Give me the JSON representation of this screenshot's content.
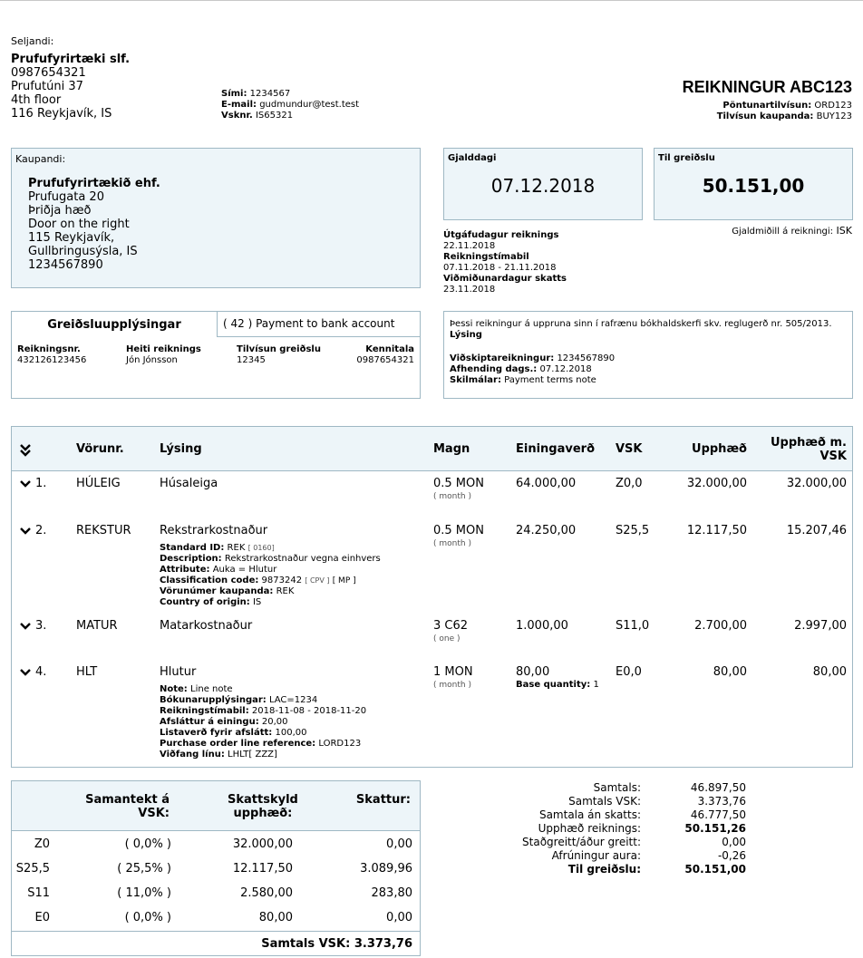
{
  "seller": {
    "label": "Seljandi:",
    "name": "Prufufyrirtæki slf.",
    "lines": [
      "0987654321",
      "Prufutúni 37",
      "4th floor",
      "116  Reykjavík, IS"
    ],
    "phone_label": "Sími:",
    "phone": "1234567",
    "email_label": "E-mail:",
    "email": "gudmundur@test.test",
    "vsk_label": "Vsknr.",
    "vsk": "IS65321"
  },
  "invoice": {
    "title": "REIKNINGUR  ABC123",
    "order_ref_label": "Pöntunartilvísun:",
    "order_ref": "ORD123",
    "buyer_ref_label": "Tilvísun kaupanda:",
    "buyer_ref": "BUY123"
  },
  "buyer": {
    "label": "Kaupandi:",
    "name": "Prufufyrirtækið ehf.",
    "lines": [
      "Prufugata 20",
      "Þriðja hæð",
      "Door on the right",
      "115  Reykjavík,",
      "Gullbringusýsla, IS",
      "1234567890"
    ]
  },
  "due": {
    "label": "Gjalddagi",
    "value": "07.12.2018"
  },
  "pay": {
    "label": "Til greiðslu",
    "value": "50.151,00"
  },
  "currency": {
    "label": "Gjaldmiðill á reikningi:",
    "value": "ISK"
  },
  "dates": {
    "issue_label": "Útgáfudagur reiknings",
    "issue": "22.11.2018",
    "period_label": "Reikningstímabil",
    "period": "07.11.2018 - 21.11.2018",
    "tax_label": "Viðmiðunardagur skatts",
    "tax": "23.11.2018"
  },
  "payment": {
    "title": "Greiðsluupplýsingar",
    "method": "( 42 ) Payment to bank account",
    "cols": [
      {
        "label": "Reikningsnr.",
        "value": "432126123456"
      },
      {
        "label": "Heiti reiknings",
        "value": "Jón Jónsson"
      },
      {
        "label": "Tilvísun greiðslu",
        "value": "12345"
      },
      {
        "label": "Kennitala",
        "value": "0987654321"
      }
    ]
  },
  "note": {
    "text": "Þessi reikningur á uppruna sinn í rafrænu bókhaldskerfi skv. reglugerð nr. 505/2013.",
    "desc_label": "Lýsing",
    "account_label": "Viðskiptareikningur:",
    "account": "1234567890",
    "delivery_label": "Afhending dags.:",
    "delivery": "07.12.2018",
    "terms_label": "Skilmálar:",
    "terms": "Payment terms note"
  },
  "lines_table": {
    "headers": {
      "product": "Vörunr.",
      "desc": "Lýsing",
      "qty": "Magn",
      "unit_price": "Einingaverð",
      "vat": "VSK",
      "amount": "Upphæð",
      "amount_vat_1": "Upphæð m.",
      "amount_vat_2": "VSK"
    },
    "rows": [
      {
        "num": "1.",
        "code": "HÚLEIG",
        "desc": "Húsaleiga",
        "qty": "0.5  MON",
        "unit": "( month )",
        "price": "64.000,00",
        "vat": "Z0,0",
        "amount": "32.000,00",
        "amount_vat": "32.000,00"
      },
      {
        "num": "2.",
        "code": "REKSTUR",
        "desc": "Rekstrarkostnaður",
        "qty": "0.5  MON",
        "unit": "( month )",
        "price": "24.250,00",
        "vat": "S25,5",
        "amount": "12.117,50",
        "amount_vat": "15.207,46",
        "details": [
          {
            "label": "Standard ID:",
            "value": "REK",
            "extra": "[ 0160]"
          },
          {
            "label": "Description:",
            "value": "Rekstrarkostnaður vegna einhvers",
            "extra": ""
          },
          {
            "label": "Attribute:",
            "value": "Auka = Hlutur",
            "extra": ""
          },
          {
            "label": "Classification code:",
            "value": "9873242",
            "extra": "[ CPV ]",
            "extra2": "[ MP ]"
          },
          {
            "label": "Vörunúmer kaupanda:",
            "value": "REK",
            "extra": ""
          },
          {
            "label": "Country of origin:",
            "value": "IS",
            "extra": ""
          }
        ]
      },
      {
        "num": "3.",
        "code": "MATUR",
        "desc": "Matarkostnaður",
        "qty": "3  C62",
        "unit": "( one )",
        "price": "1.000,00",
        "vat": "S11,0",
        "amount": "2.700,00",
        "amount_vat": "2.997,00"
      },
      {
        "num": "4.",
        "code": "HLT",
        "desc": "Hlutur",
        "qty": "1  MON",
        "unit": "( month )",
        "price": "80,00",
        "vat": "E0,0",
        "amount": "80,00",
        "amount_vat": "80,00",
        "base_label": "Base quantity:",
        "base_value": "1",
        "details": [
          {
            "label": "Note:",
            "value": "Line note"
          },
          {
            "label": "Bókunarupplýsingar:",
            "value": "LAC=1234"
          },
          {
            "label": "Reikningstímabil:",
            "value": "2018-11-08 -  2018-11-20"
          },
          {
            "label": "Afsláttur á einingu:",
            "value": "20,00"
          },
          {
            "label": "Listaverð fyrir afslátt:",
            "value": "100,00"
          },
          {
            "label": "Purchase order line reference:",
            "value": "LORD123"
          },
          {
            "label": "Viðfang línu:",
            "value": "LHLT[ ZZZ]"
          }
        ]
      }
    ]
  },
  "vat_summary": {
    "h1a": "Samantekt á",
    "h1b": "VSK:",
    "h2a": "Skattskyld",
    "h2b": "upphæð:",
    "h3": "Skattur:",
    "rows": [
      {
        "code": "Z0",
        "rate": "( 0,0% )",
        "base": "32.000,00",
        "tax": "0,00"
      },
      {
        "code": "S25,5",
        "rate": "( 25,5% )",
        "base": "12.117,50",
        "tax": "3.089,96"
      },
      {
        "code": "S11",
        "rate": "( 11,0% )",
        "base": "2.580,00",
        "tax": "283,80"
      },
      {
        "code": "E0",
        "rate": "( 0,0% )",
        "base": "80,00",
        "tax": "0,00"
      }
    ],
    "total": "Samtals VSK: 3.373,76"
  },
  "totals": [
    {
      "label": "Samtals:",
      "value": "46.897,50",
      "bold": false
    },
    {
      "label": "Samtals VSK:",
      "value": "3.373,76",
      "bold": false
    },
    {
      "label": "Samtala án skatts:",
      "value": "46.777,50",
      "bold": false
    },
    {
      "label": "Upphæð reiknings:",
      "value": "50.151,26",
      "bold": true
    },
    {
      "label": "Staðgreitt/áður greitt:",
      "value": "0,00",
      "bold": false
    },
    {
      "label": "Afrúningur aura:",
      "value": "-0,26",
      "bold": false
    },
    {
      "label": "Til greiðslu:",
      "value": "50.151,00",
      "bold": true
    }
  ]
}
